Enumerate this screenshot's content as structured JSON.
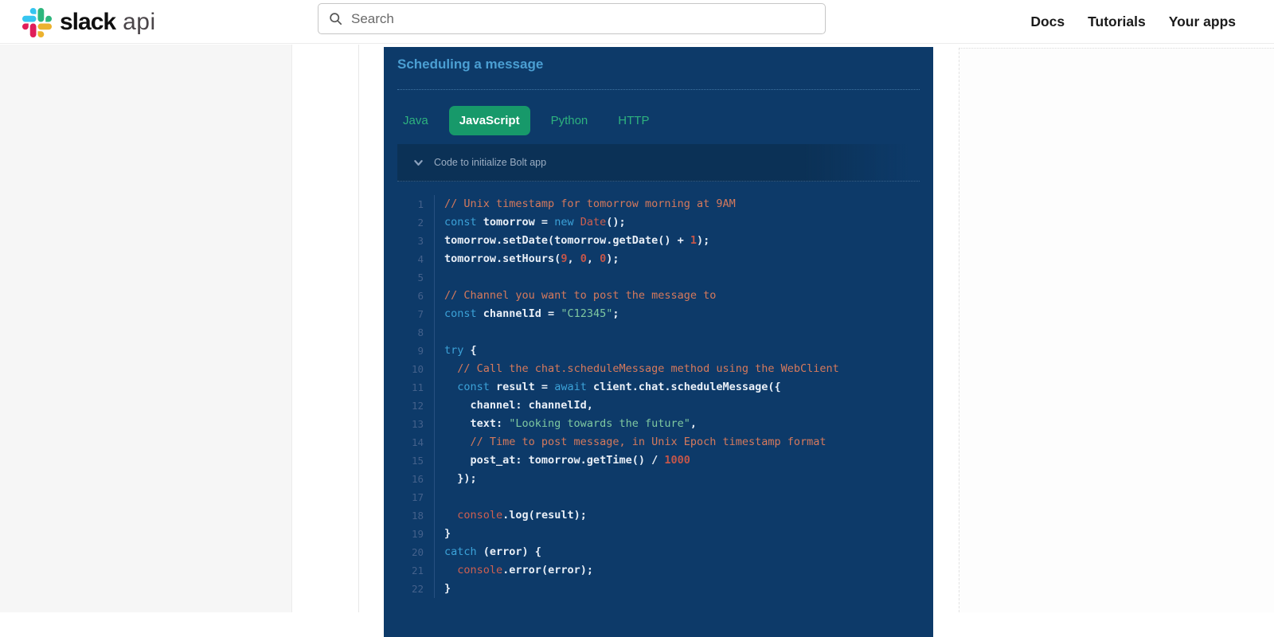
{
  "header": {
    "brand": {
      "name": "slack",
      "suffix": "api"
    },
    "search": {
      "placeholder": "Search",
      "value": ""
    },
    "nav": [
      {
        "label": "Docs"
      },
      {
        "label": "Tutorials"
      },
      {
        "label": "Your apps"
      }
    ]
  },
  "panel": {
    "title": "Scheduling a message",
    "tabs": [
      {
        "label": "Java",
        "active": false
      },
      {
        "label": "JavaScript",
        "active": true
      },
      {
        "label": "Python",
        "active": false
      },
      {
        "label": "HTTP",
        "active": false
      }
    ],
    "collapsible": {
      "label": "Code to initialize Bolt app",
      "state": "expanded",
      "icon": "chevron-down-icon"
    }
  },
  "code": {
    "language": "JavaScript",
    "line_count": 22,
    "lines": [
      [
        {
          "c": "comment",
          "t": "// Unix timestamp for tomorrow morning at 9AM"
        }
      ],
      [
        {
          "c": "kw",
          "t": "const"
        },
        {
          "c": "plain",
          "t": " tomorrow = "
        },
        {
          "c": "kw",
          "t": "new"
        },
        {
          "c": "plain",
          "t": " "
        },
        {
          "c": "red",
          "t": "Date"
        },
        {
          "c": "plain",
          "t": "();"
        }
      ],
      [
        {
          "c": "plain",
          "t": "tomorrow.setDate(tomorrow.getDate() + "
        },
        {
          "c": "num",
          "t": "1"
        },
        {
          "c": "plain",
          "t": ");"
        }
      ],
      [
        {
          "c": "plain",
          "t": "tomorrow.setHours("
        },
        {
          "c": "num",
          "t": "9"
        },
        {
          "c": "plain",
          "t": ", "
        },
        {
          "c": "num",
          "t": "0"
        },
        {
          "c": "plain",
          "t": ", "
        },
        {
          "c": "num",
          "t": "0"
        },
        {
          "c": "plain",
          "t": ");"
        }
      ],
      [],
      [
        {
          "c": "comment",
          "t": "// Channel you want to post the message to"
        }
      ],
      [
        {
          "c": "kw",
          "t": "const"
        },
        {
          "c": "plain",
          "t": " channelId = "
        },
        {
          "c": "str",
          "t": "\"C12345\""
        },
        {
          "c": "plain",
          "t": ";"
        }
      ],
      [],
      [
        {
          "c": "kw",
          "t": "try"
        },
        {
          "c": "plain",
          "t": " {"
        }
      ],
      [
        {
          "c": "plain",
          "t": "  "
        },
        {
          "c": "comment",
          "t": "// Call the chat.scheduleMessage method using the WebClient"
        }
      ],
      [
        {
          "c": "plain",
          "t": "  "
        },
        {
          "c": "kw",
          "t": "const"
        },
        {
          "c": "plain",
          "t": " result = "
        },
        {
          "c": "kw",
          "t": "await"
        },
        {
          "c": "plain",
          "t": " client.chat.scheduleMessage({"
        }
      ],
      [
        {
          "c": "plain",
          "t": "    channel: channelId,"
        }
      ],
      [
        {
          "c": "plain",
          "t": "    text: "
        },
        {
          "c": "str",
          "t": "\"Looking towards the future\""
        },
        {
          "c": "plain",
          "t": ","
        }
      ],
      [
        {
          "c": "plain",
          "t": "    "
        },
        {
          "c": "comment",
          "t": "// Time to post message, in Unix Epoch timestamp format"
        }
      ],
      [
        {
          "c": "plain",
          "t": "    post_at: tomorrow.getTime() / "
        },
        {
          "c": "num",
          "t": "1000"
        }
      ],
      [
        {
          "c": "plain",
          "t": "  });"
        }
      ],
      [],
      [
        {
          "c": "plain",
          "t": "  "
        },
        {
          "c": "red",
          "t": "console"
        },
        {
          "c": "plain",
          "t": ".log(result);"
        }
      ],
      [
        {
          "c": "plain",
          "t": "}"
        }
      ],
      [
        {
          "c": "kw",
          "t": "catch"
        },
        {
          "c": "plain",
          "t": " (error) {"
        }
      ],
      [
        {
          "c": "plain",
          "t": "  "
        },
        {
          "c": "red",
          "t": "console"
        },
        {
          "c": "plain",
          "t": ".error(error);"
        }
      ],
      [
        {
          "c": "plain",
          "t": "}"
        }
      ]
    ]
  },
  "theme": {
    "panel_bg": "#0d3a69",
    "collapse_row_bg": "#0b3156",
    "title_blue": "#4b9fd3",
    "tab_green_text": "#2eb27e",
    "tab_active_bg": "#17996a",
    "code_comment": "#d5795c",
    "code_keyword": "#3ca2d8",
    "code_literal": "#c4564a",
    "code_string": "#7fc8a0",
    "code_plain": "#e9eff7",
    "line_number": "#44618b",
    "slack_blue": "#36C5F0",
    "slack_green": "#2EB67D",
    "slack_yellow": "#ECB22E",
    "slack_red": "#E01E5A"
  }
}
